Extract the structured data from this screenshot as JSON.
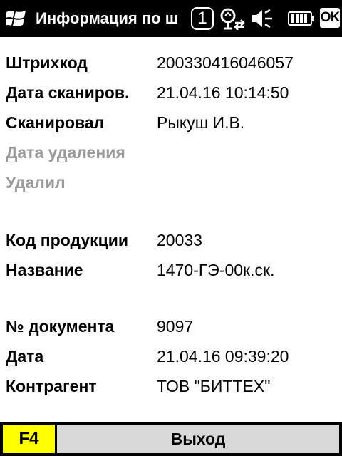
{
  "titlebar": {
    "title": "Информация по ш",
    "notification_count": "1",
    "ok_label": "OK",
    "icons": [
      "windows-logo-icon",
      "network-icon",
      "volume-muted-icon",
      "battery-icon"
    ]
  },
  "fields": {
    "barcode": {
      "label": "Штрихкод",
      "value": "200330416046057"
    },
    "scan_date": {
      "label": "Дата сканиров.",
      "value": "21.04.16 10:14:50"
    },
    "scanned_by": {
      "label": "Сканировал",
      "value": "Рыкуш И.В."
    },
    "delete_date": {
      "label": "Дата удаления",
      "value": ""
    },
    "deleted_by": {
      "label": "Удалил",
      "value": ""
    },
    "product_code": {
      "label": "Код продукции",
      "value": "20033"
    },
    "name": {
      "label": "Название",
      "value": "1470-ГЭ-00к.ск."
    },
    "doc_number": {
      "label": "№ документа",
      "value": "9097"
    },
    "date": {
      "label": "Дата",
      "value": "21.04.16 09:39:20"
    },
    "counterparty": {
      "label": "Контрагент",
      "value": "ТОВ \"БИТТЕХ\""
    }
  },
  "softkeys": {
    "f4_label": "F4",
    "exit_label": "Выход"
  },
  "colors": {
    "titlebar_bg": "#000000",
    "f4_bg": "#ffff00",
    "exit_bg": "#d9d9d9",
    "disabled_label": "#9a9a9a"
  }
}
